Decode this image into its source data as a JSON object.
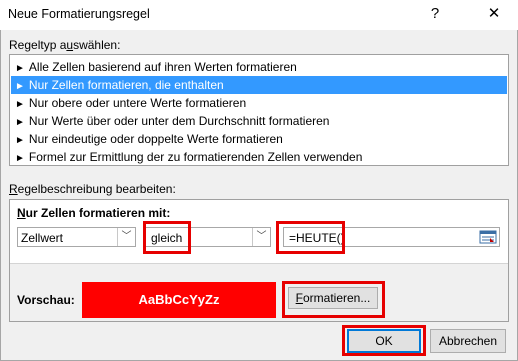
{
  "window": {
    "title": "Neue Formatierungsregel",
    "help_label": "?",
    "close_label": "✕"
  },
  "ruletype": {
    "label_pre": "Regeltyp a",
    "label_hot": "u",
    "label_post": "swählen:",
    "items": [
      "Alle Zellen basierend auf ihren Werten formatieren",
      "Nur Zellen formatieren, die enthalten",
      "Nur obere oder untere Werte formatieren",
      "Nur Werte über oder unter dem Durchschnitt formatieren",
      "Nur eindeutige oder doppelte Werte formatieren",
      "Formel zur Ermittlung der zu formatierenden Zellen verwenden"
    ],
    "selected_index": 1
  },
  "description": {
    "label_pre": "",
    "label_hot": "R",
    "label_post": "egelbeschreibung bearbeiten:",
    "panel_title_hot": "N",
    "panel_title_rest": "ur Zellen formatieren mit:",
    "combo_field": "Zellwert",
    "combo_operator": "gleich",
    "value_input": "=HEUTE()",
    "preview_label": "Vorschau:",
    "preview_text": "AaBbCcYyZz",
    "format_button_hot": "F",
    "format_button_rest": "ormatieren..."
  },
  "buttons": {
    "ok": "OK",
    "cancel": "Abbrechen"
  },
  "colors": {
    "selection": "#3399ff",
    "preview_fill": "#ff0000",
    "highlight": "#e60000",
    "focus": "#0078d7"
  }
}
